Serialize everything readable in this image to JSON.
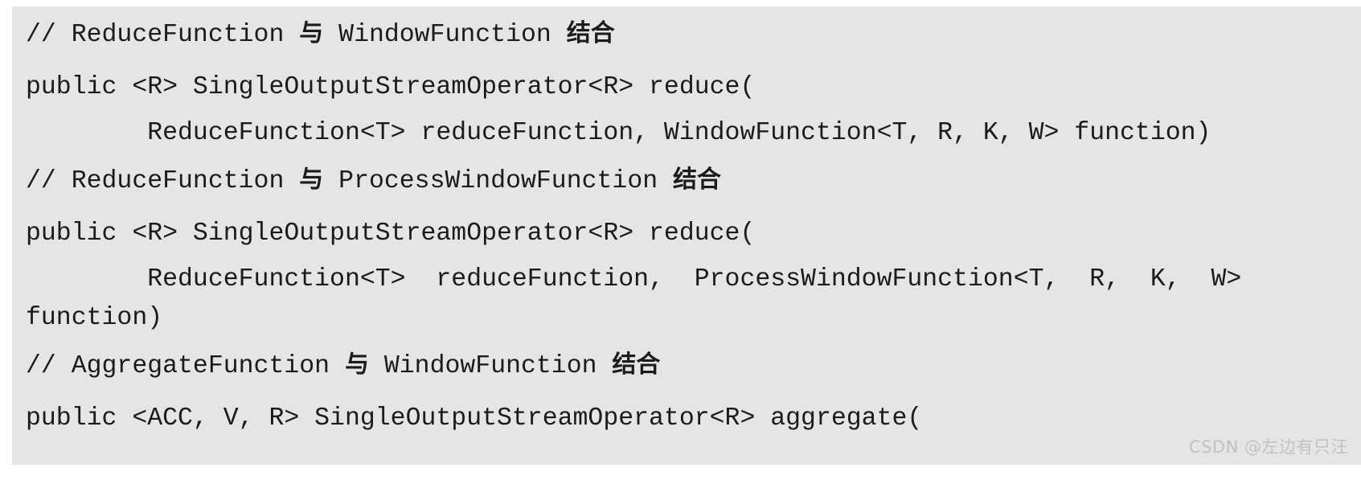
{
  "code_block": {
    "background_color": "#e5e5e5",
    "text_color": "#1b1b1b",
    "language": "java",
    "lines": [
      {
        "id": "line-1",
        "type": "comment",
        "text": "// ReduceFunction 与 WindowFunction 结合"
      },
      {
        "id": "line-2",
        "type": "code",
        "text": "public <R> SingleOutputStreamOperator<R> reduce("
      },
      {
        "id": "line-3",
        "type": "code",
        "text": "        ReduceFunction<T> reduceFunction, WindowFunction<T, R, K, W> function)"
      },
      {
        "id": "line-4",
        "type": "comment",
        "text": "// ReduceFunction 与 ProcessWindowFunction 结合"
      },
      {
        "id": "line-5",
        "type": "code",
        "text": "public <R> SingleOutputStreamOperator<R> reduce("
      },
      {
        "id": "line-6",
        "type": "code",
        "text": "        ReduceFunction<T>  reduceFunction,  ProcessWindowFunction<T,  R,  K,  W>"
      },
      {
        "id": "line-7",
        "type": "code",
        "text": "function)"
      },
      {
        "id": "line-8",
        "type": "comment",
        "text": "// AggregateFunction 与 WindowFunction 结合"
      },
      {
        "id": "line-9",
        "type": "code",
        "text": "public <ACC, V, R> SingleOutputStreamOperator<R> aggregate("
      }
    ]
  },
  "watermark": {
    "text": "CSDN @左边有只汪",
    "color": "#c2c2c2"
  }
}
